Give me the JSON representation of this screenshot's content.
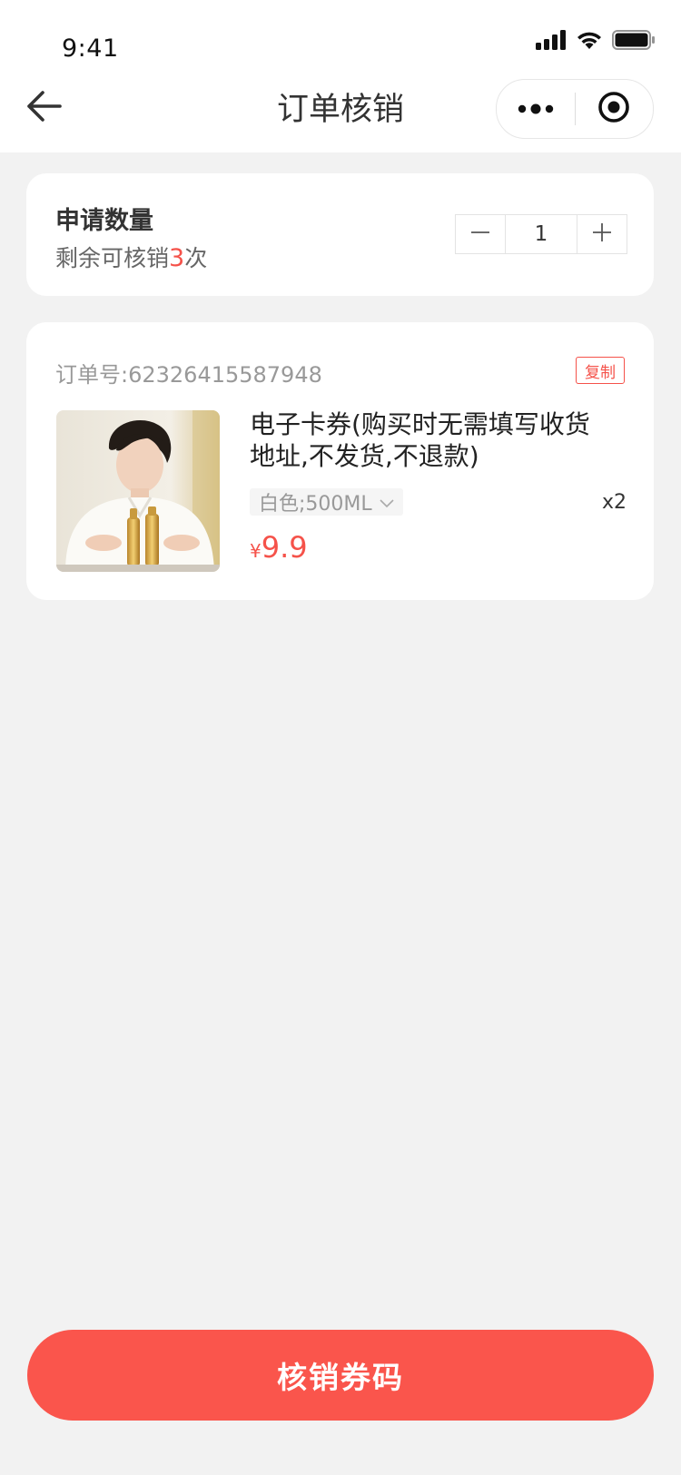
{
  "status_bar": {
    "time": "9:41"
  },
  "nav": {
    "title": "订单核销",
    "back_icon": "arrow-left-icon",
    "more_icon": "more-dots-icon",
    "close_icon": "target-circle-icon"
  },
  "quantity": {
    "title": "申请数量",
    "remain_prefix": "剩余可核销",
    "remain_count": "3",
    "remain_suffix": "次",
    "value": "1",
    "minus_icon": "minus-icon",
    "plus_icon": "plus-icon"
  },
  "order": {
    "number_label": "订单号:",
    "number": "62326415587948",
    "copy_label": "复制",
    "product_name": "电子卡券(购买时无需填写收货地址,不发货,不退款)",
    "spec": "白色;500ML",
    "spec_icon": "chevron-down-icon",
    "quantity": "x2",
    "currency": "¥",
    "price": "9.9"
  },
  "action": {
    "button_label": "核销券码"
  },
  "colors": {
    "accent": "#f5524a",
    "button": "#fa554c",
    "background": "#f2f2f2"
  }
}
